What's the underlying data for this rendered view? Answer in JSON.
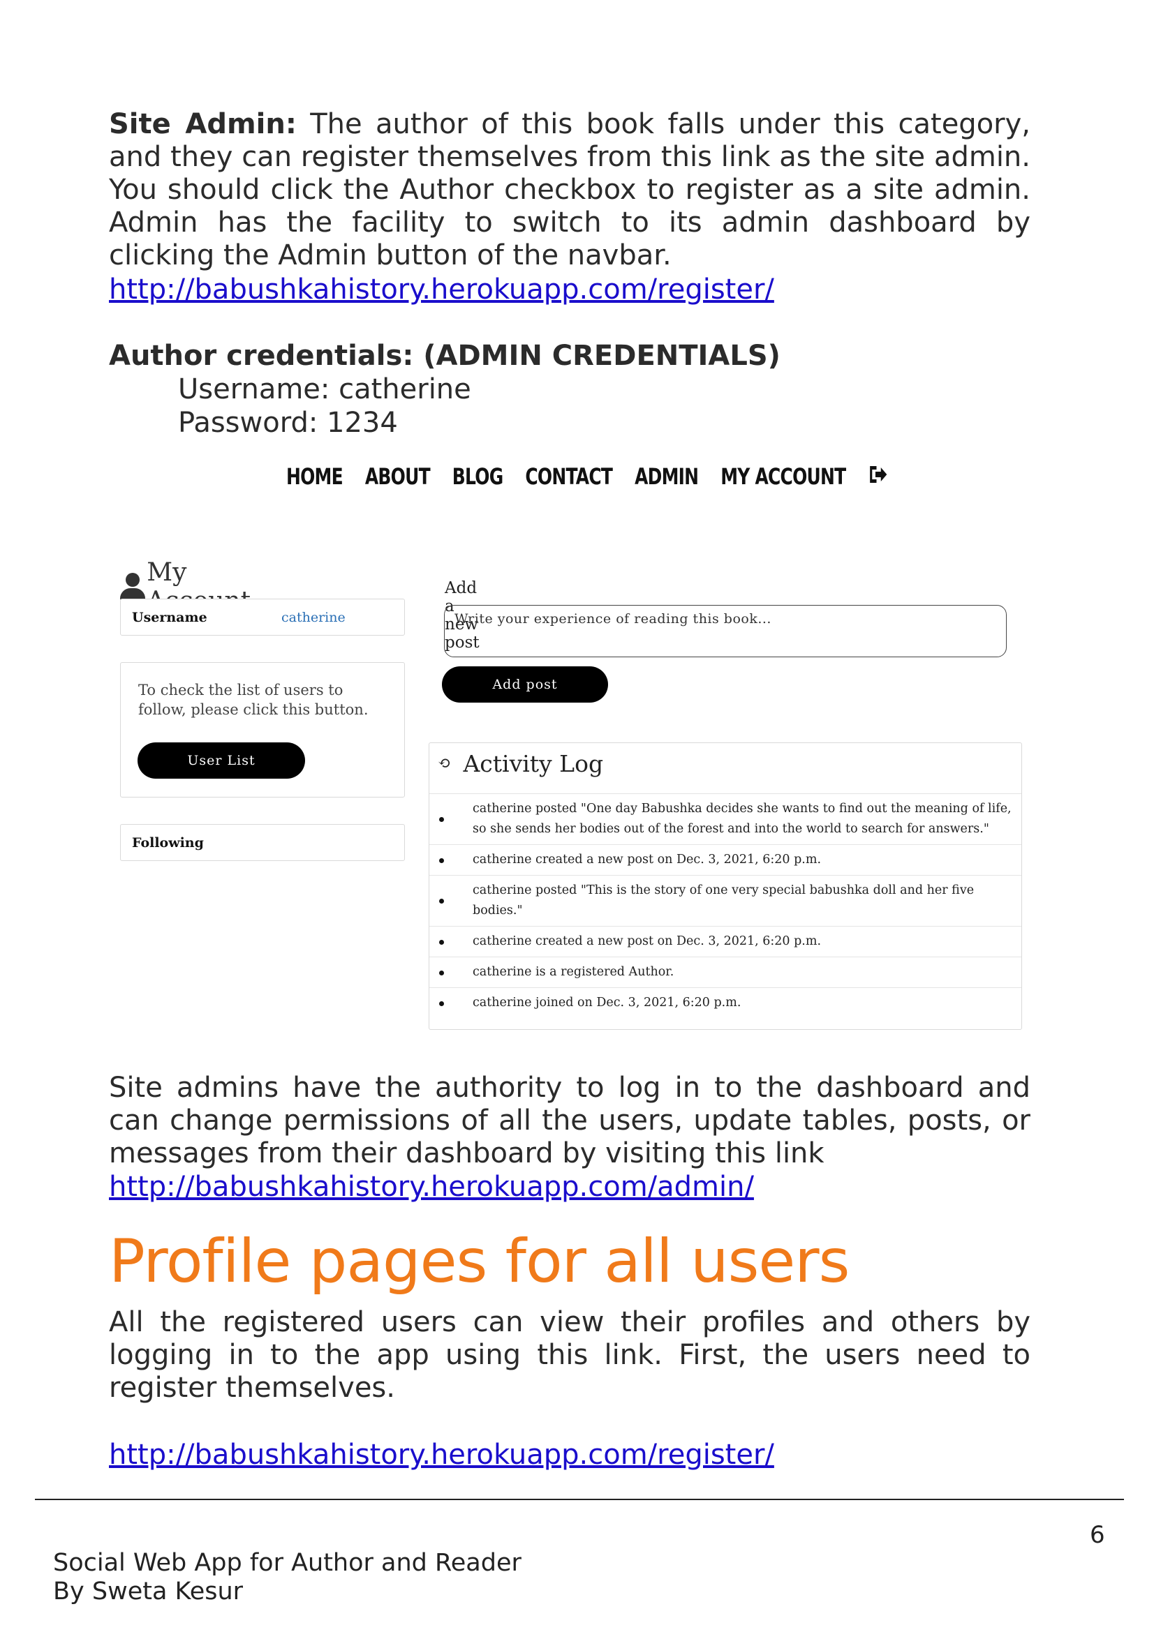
{
  "intro": {
    "label": "Site Admin:",
    "text": " The author of this book falls under this category, and they can register themselves from this link as the site admin. You should click the Author checkbox to register as a site admin. Admin has the facility to switch to its admin dashboard by clicking the Admin button of the navbar.",
    "link": "http://babushkahistory.herokuapp.com/register/"
  },
  "credentials": {
    "heading": "Author credentials: (ADMIN CREDENTIALS)",
    "username": "Username: catherine",
    "password": "Password: 1234"
  },
  "screenshot": {
    "nav": [
      "HOME",
      "ABOUT",
      "BLOG",
      "CONTACT",
      "ADMIN",
      "MY ACCOUNT"
    ],
    "logout_icon": "sign-out-icon",
    "account_title": "My Account",
    "username_label": "Username",
    "username_value": "catherine",
    "check_text": "To check the list of users to follow, please click this button.",
    "user_list_button": "User List",
    "following_label": "Following",
    "add_post_label": "Add a new post",
    "post_placeholder": "Write your experience of reading this book...",
    "add_post_button": "Add post",
    "activity_title": "Activity Log",
    "activity": [
      "catherine posted \"One day Babushka decides she wants to find out the meaning of life, so she sends her bodies out of the forest and into the world to search for answers.\"",
      "catherine created a new post on Dec. 3, 2021, 6:20 p.m.",
      "catherine posted \"This is the story of one very special babushka doll and her five bodies.\"",
      "catherine created a new post on Dec. 3, 2021, 6:20 p.m.",
      "catherine is a registered Author.",
      "catherine joined on Dec. 3, 2021, 6:20 p.m."
    ]
  },
  "admin_para": {
    "text": "Site admins have the authority to log in to the dashboard and can change permissions of all the users, update tables, posts, or messages from their dashboard by visiting this link",
    "link": "http://babushkahistory.herokuapp.com/admin/"
  },
  "profile": {
    "title": "Profile pages for all users",
    "text": "All the registered users can view their profiles and others by logging in to the app using this link. First, the users need to register themselves.",
    "link": "http://babushkahistory.herokuapp.com/register/"
  },
  "footer": {
    "page_number": "6",
    "line1": "Social Web App for Author and Reader",
    "line2": "By Sweta Kesur"
  }
}
